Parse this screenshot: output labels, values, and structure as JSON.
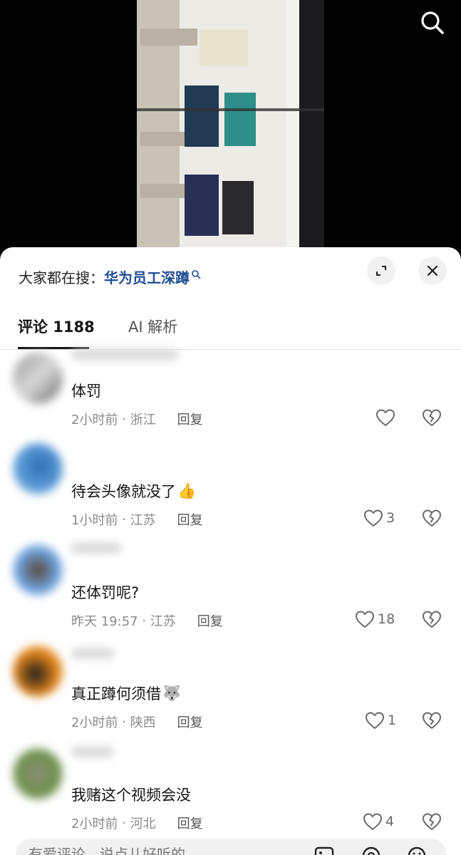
{
  "header": {
    "search_prefix": "大家都在搜：",
    "search_term": "华为员工深蹲"
  },
  "tabs": [
    {
      "label": "评论 1188"
    },
    {
      "label": "AI 解析"
    }
  ],
  "comments": [
    {
      "text": "体罚",
      "time": "2小时前",
      "location": "浙江",
      "reply": "回复",
      "likes": ""
    },
    {
      "text": "待会头像就没了",
      "emoji": "👍",
      "time": "1小时前",
      "location": "江苏",
      "reply": "回复",
      "likes": "3"
    },
    {
      "text": "还体罚呢?",
      "time": "昨天 19:57",
      "location": "江苏",
      "reply": "回复",
      "likes": "18"
    },
    {
      "text": "真正蹲何须借",
      "emoji": "🐺",
      "time": "2小时前",
      "location": "陕西",
      "reply": "回复",
      "likes": "1"
    },
    {
      "text": "我赌这个视频会没",
      "time": "2小时前",
      "location": "河北",
      "reply": "回复",
      "likes": "4"
    }
  ],
  "input": {
    "placeholder": "有爱评论，说点儿好听的"
  },
  "colors": {
    "link": "#1f4d93",
    "text": "#161616",
    "meta": "#8a8a8a"
  }
}
